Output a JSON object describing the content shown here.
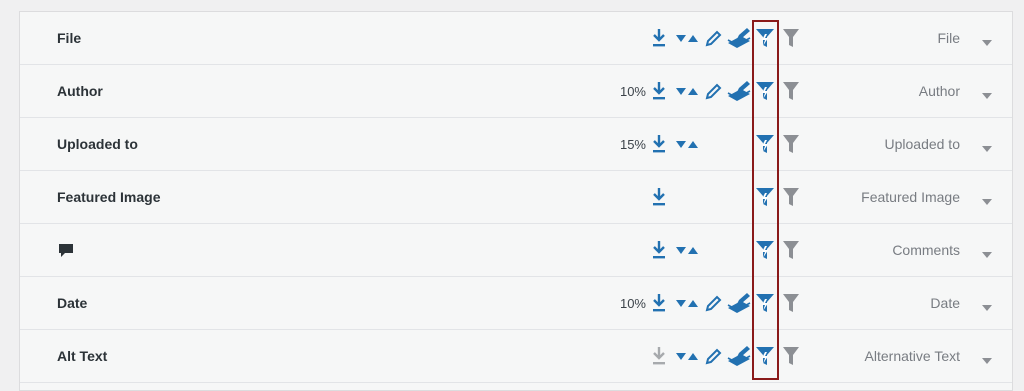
{
  "colors": {
    "accent_blue": "#2271b1",
    "filter_gray": "#8c8f94",
    "highlight_red": "#8a1a1a"
  },
  "icons": {
    "download": "download-icon",
    "sort": "sort-icon",
    "edit": "pencil-icon",
    "bulk_edit": "bulk-edit-icon",
    "smart_filter": "smart-filter-icon",
    "filter": "filter-icon",
    "caret": "caret-down-icon",
    "comment": "comment-icon"
  },
  "rows": [
    {
      "label": "File",
      "percent": "",
      "header_name": "File"
    },
    {
      "label": "Author",
      "percent": "10%",
      "header_name": "Author"
    },
    {
      "label": "Uploaded to",
      "percent": "15%",
      "header_name": "Uploaded to"
    },
    {
      "label": "Featured Image",
      "percent": "",
      "header_name": "Featured Image"
    },
    {
      "label": "",
      "percent": "",
      "header_name": "Comments"
    },
    {
      "label": "Date",
      "percent": "10%",
      "header_name": "Date"
    },
    {
      "label": "Alt Text",
      "percent": "",
      "header_name": "Alternative Text"
    }
  ]
}
